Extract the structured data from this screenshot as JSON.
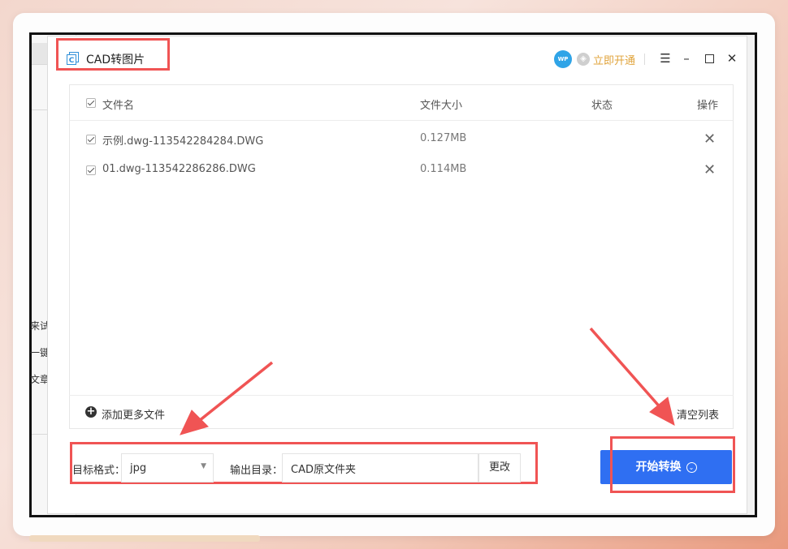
{
  "window": {
    "title": "CAD转图片",
    "avatar_text": "WP",
    "vip_link": "立即开通"
  },
  "table": {
    "headers": {
      "name": "文件名",
      "size": "文件大小",
      "status": "状态",
      "action": "操作"
    },
    "rows": [
      {
        "name": "示例.dwg-113542284284.DWG",
        "size": "0.127MB",
        "status": "",
        "checked": true
      },
      {
        "name": "01.dwg-113542286286.DWG",
        "size": "0.114MB",
        "status": "",
        "checked": true
      }
    ]
  },
  "footer": {
    "add_more": "添加更多文件",
    "clear_list": "清空列表"
  },
  "settings": {
    "format_label": "目标格式：",
    "format_value": "jpg",
    "output_label": "输出目录：",
    "output_value": "CAD原文件夹",
    "change_button": "更改"
  },
  "start_button": "开始转换",
  "background_doc": {
    "text_1": "来试",
    "text_2": "一键",
    "text_3": "文章"
  },
  "colors": {
    "accent": "#2f6ff2",
    "highlight": "#f05454",
    "vip": "#e0a33a"
  }
}
